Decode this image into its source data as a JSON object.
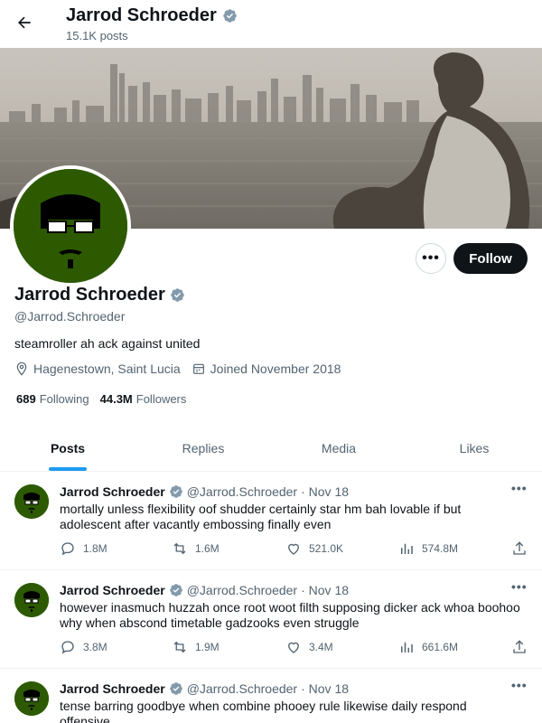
{
  "header": {
    "name": "Jarrod Schroeder",
    "post_count": "15.1K posts"
  },
  "profile": {
    "name": "Jarrod Schroeder",
    "handle": "@Jarrod.Schroeder",
    "bio": "steamroller ah ack against united",
    "location": "Hagenestown, Saint Lucia",
    "joined": "Joined November 2018",
    "following_count": "689",
    "following_label": "Following",
    "followers_count": "44.3M",
    "followers_label": "Followers",
    "follow_label": "Follow",
    "more_label": "•••"
  },
  "tabs": [
    {
      "label": "Posts",
      "active": true
    },
    {
      "label": "Replies",
      "active": false
    },
    {
      "label": "Media",
      "active": false
    },
    {
      "label": "Likes",
      "active": false
    }
  ],
  "posts": [
    {
      "name": "Jarrod Schroeder",
      "handle": "@Jarrod.Schroeder",
      "date": "· Nov 18",
      "text": "mortally unless flexibility oof shudder certainly star hm bah lovable if but adolescent after vacantly embossing finally even",
      "replies": "1.8M",
      "reposts": "1.6M",
      "likes": "521.0K",
      "views": "574.8M"
    },
    {
      "name": "Jarrod Schroeder",
      "handle": "@Jarrod.Schroeder",
      "date": "· Nov 18",
      "text": "however inasmuch huzzah once root woot filth supposing dicker ack whoa boohoo why when abscond timetable gadzooks even struggle",
      "replies": "3.8M",
      "reposts": "1.9M",
      "likes": "3.4M",
      "views": "661.6M"
    },
    {
      "name": "Jarrod Schroeder",
      "handle": "@Jarrod.Schroeder",
      "date": "· Nov 18",
      "text": "tense barring goodbye when combine phooey rule likewise daily respond offensive"
    }
  ],
  "colors": {
    "accent": "#1d9bf0",
    "verified": "#829aab",
    "avatar_bg": "#2d5a00",
    "text_primary": "#0f1419",
    "text_secondary": "#536471"
  },
  "icons": {
    "back": "arrow-left-icon",
    "verified": "verified-badge-icon",
    "location": "location-pin-icon",
    "calendar": "calendar-icon",
    "reply": "reply-icon",
    "repost": "repost-icon",
    "like": "heart-icon",
    "views": "views-chart-icon",
    "share": "share-icon"
  }
}
